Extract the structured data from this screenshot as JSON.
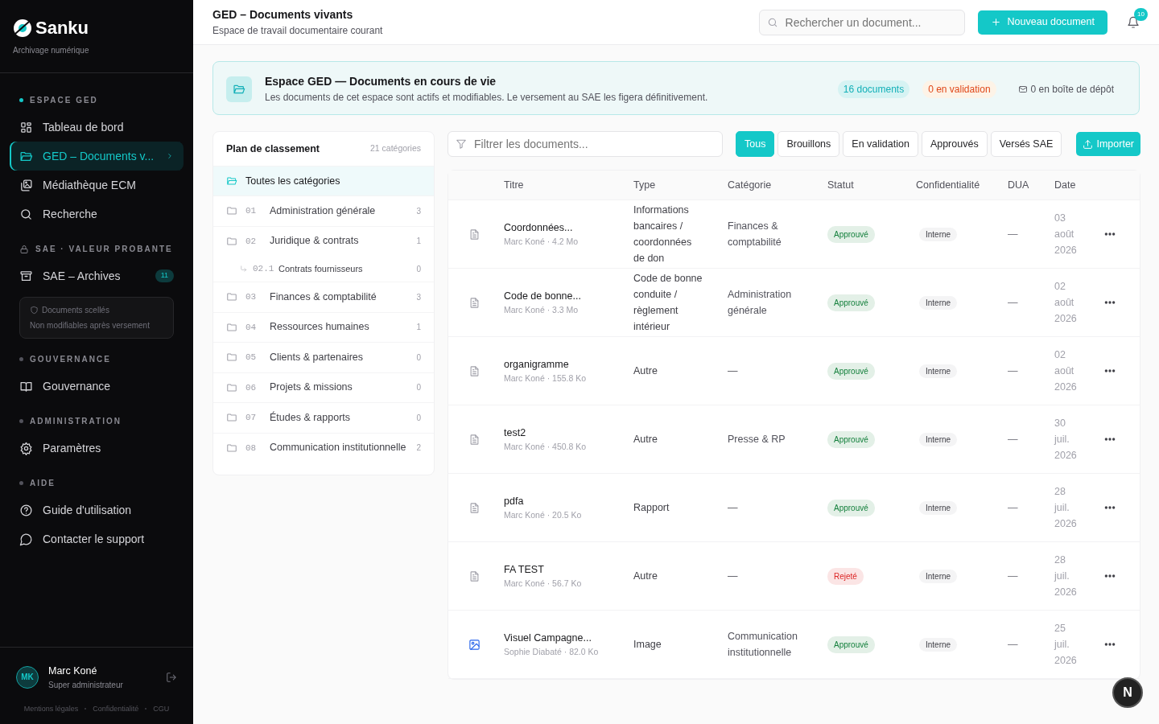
{
  "brand": {
    "name": "Sanku",
    "tagline": "Archivage numérique"
  },
  "nav_sections": [
    {
      "title": "ESPACE GED",
      "kind": "dot",
      "items": [
        {
          "label": "Tableau de bord",
          "selected": false
        },
        {
          "label": "GED – Documents v...",
          "selected": true
        },
        {
          "label": "Médiathèque ECM",
          "selected": false
        },
        {
          "label": "Recherche",
          "selected": false
        }
      ]
    },
    {
      "title": "SAE · VALEUR PROBANTE",
      "kind": "lock",
      "items": [
        {
          "label": "SAE – Archives",
          "selected": false,
          "badge": "11"
        }
      ],
      "note": {
        "title": "Documents scellés",
        "text": "Non modifiables après versement"
      }
    },
    {
      "title": "GOUVERNANCE",
      "kind": "dot",
      "items": [
        {
          "label": "Gouvernance",
          "selected": false
        }
      ]
    },
    {
      "title": "ADMINISTRATION",
      "kind": "dot",
      "items": [
        {
          "label": "Paramètres",
          "selected": false
        }
      ]
    },
    {
      "title": "AIDE",
      "kind": "dot",
      "items": [
        {
          "label": "Guide d'utilisation",
          "selected": false
        },
        {
          "label": "Contacter le support",
          "selected": false
        }
      ]
    }
  ],
  "user": {
    "initials": "MK",
    "name": "Marc Koné",
    "role": "Super administrateur"
  },
  "footer_links": [
    "Mentions légales",
    "Confidentialité",
    "CGU"
  ],
  "header": {
    "title": "GED – Documents vivants",
    "subtitle": "Espace de travail documentaire courant",
    "search_placeholder": "Rechercher un document...",
    "new_button": "Nouveau document",
    "notifications": "10"
  },
  "banner": {
    "title": "Espace GED — Documents en cours de vie",
    "text": "Les documents de cet espace sont actifs et modifiables. Le versement au SAE les figera définitivement.",
    "stats": [
      {
        "label": "16 documents",
        "kind": "info"
      },
      {
        "label": "0 en validation",
        "kind": "warning"
      },
      {
        "label": "0 en boîte de dépôt",
        "kind": "inbox"
      }
    ]
  },
  "classification": {
    "title": "Plan de classement",
    "count": "21 catégories",
    "all": {
      "label": "Toutes les catégories",
      "selected": true
    },
    "categories": [
      {
        "code": "01",
        "label": "Administration générale",
        "count": "3",
        "selected": false
      },
      {
        "code": "02",
        "label": "Juridique & contrats",
        "count": "1",
        "selected": false,
        "children": [
          {
            "code": "02.1",
            "label": "Contrats fournisseurs",
            "count": "0",
            "selected": false
          }
        ]
      },
      {
        "code": "03",
        "label": "Finances & comptabilité",
        "count": "3",
        "selected": false
      },
      {
        "code": "04",
        "label": "Ressources humaines",
        "count": "1",
        "selected": false
      },
      {
        "code": "05",
        "label": "Clients & partenaires",
        "count": "0",
        "selected": false
      },
      {
        "code": "06",
        "label": "Projets & missions",
        "count": "0",
        "selected": false
      },
      {
        "code": "07",
        "label": "Études & rapports",
        "count": "0",
        "selected": false
      },
      {
        "code": "08",
        "label": "Communication institutionnelle",
        "count": "2",
        "selected": false
      }
    ]
  },
  "filter_placeholder": "Filtrer les documents...",
  "filters": [
    {
      "label": "Tous",
      "selected": true
    },
    {
      "label": "Brouillons",
      "selected": false
    },
    {
      "label": "En validation",
      "selected": false
    },
    {
      "label": "Approuvés",
      "selected": false
    },
    {
      "label": "Versés SAE",
      "selected": false
    }
  ],
  "import_button": "Importer",
  "table": {
    "columns": [
      "Titre",
      "Type",
      "Catégorie",
      "Statut",
      "Confidentialité",
      "DUA",
      "Date"
    ],
    "rows": [
      {
        "kind": "document",
        "title": "Coordonnées...",
        "meta": "Marc Koné · 4.2 Mo",
        "type": "Informations bancaires / coordonnées de don",
        "category": "Finances & comptabilité",
        "status": {
          "label": "Approuvé",
          "color": "#15803d"
        },
        "confidentiality": "Interne",
        "dua": "—",
        "date": "03 août 2026"
      },
      {
        "kind": "document",
        "title": "Code de bonne...",
        "meta": "Marc Koné · 3.3 Mo",
        "type": "Code de bonne conduite / règlement intérieur",
        "category": "Administration générale",
        "status": {
          "label": "Approuvé",
          "color": "#15803d"
        },
        "confidentiality": "Interne",
        "dua": "—",
        "date": "02 août 2026"
      },
      {
        "kind": "document",
        "title": "organigramme",
        "meta": "Marc Koné · 155.8 Ko",
        "type": "Autre",
        "category": "—",
        "status": {
          "label": "Approuvé",
          "color": "#15803d"
        },
        "confidentiality": "Interne",
        "dua": "—",
        "date": "02 août 2026"
      },
      {
        "kind": "document",
        "title": "test2",
        "meta": "Marc Koné · 450.8 Ko",
        "type": "Autre",
        "category": "Presse & RP",
        "status": {
          "label": "Approuvé",
          "color": "#15803d"
        },
        "confidentiality": "Interne",
        "dua": "—",
        "date": "30 juil. 2026"
      },
      {
        "kind": "document",
        "title": "pdfa",
        "meta": "Marc Koné · 20.5 Ko",
        "type": "Rapport",
        "category": "—",
        "status": {
          "label": "Approuvé",
          "color": "#15803d"
        },
        "confidentiality": "Interne",
        "dua": "—",
        "date": "28 juil. 2026"
      },
      {
        "kind": "document",
        "title": "FA TEST",
        "meta": "Marc Koné · 56.7 Ko",
        "type": "Autre",
        "category": "—",
        "status": {
          "label": "Rejeté",
          "color": "#dc2626"
        },
        "confidentiality": "Interne",
        "dua": "—",
        "date": "28 juil. 2026"
      },
      {
        "kind": "image",
        "title": "Visuel Campagne...",
        "meta": "Sophie Diabaté · 82.0 Ko",
        "type": "Image",
        "category": "Communication institutionnelle",
        "status": {
          "label": "Approuvé",
          "color": "#15803d"
        },
        "confidentiality": "Interne",
        "dua": "—",
        "date": "25 juil. 2026"
      }
    ]
  },
  "dev_button": "N"
}
